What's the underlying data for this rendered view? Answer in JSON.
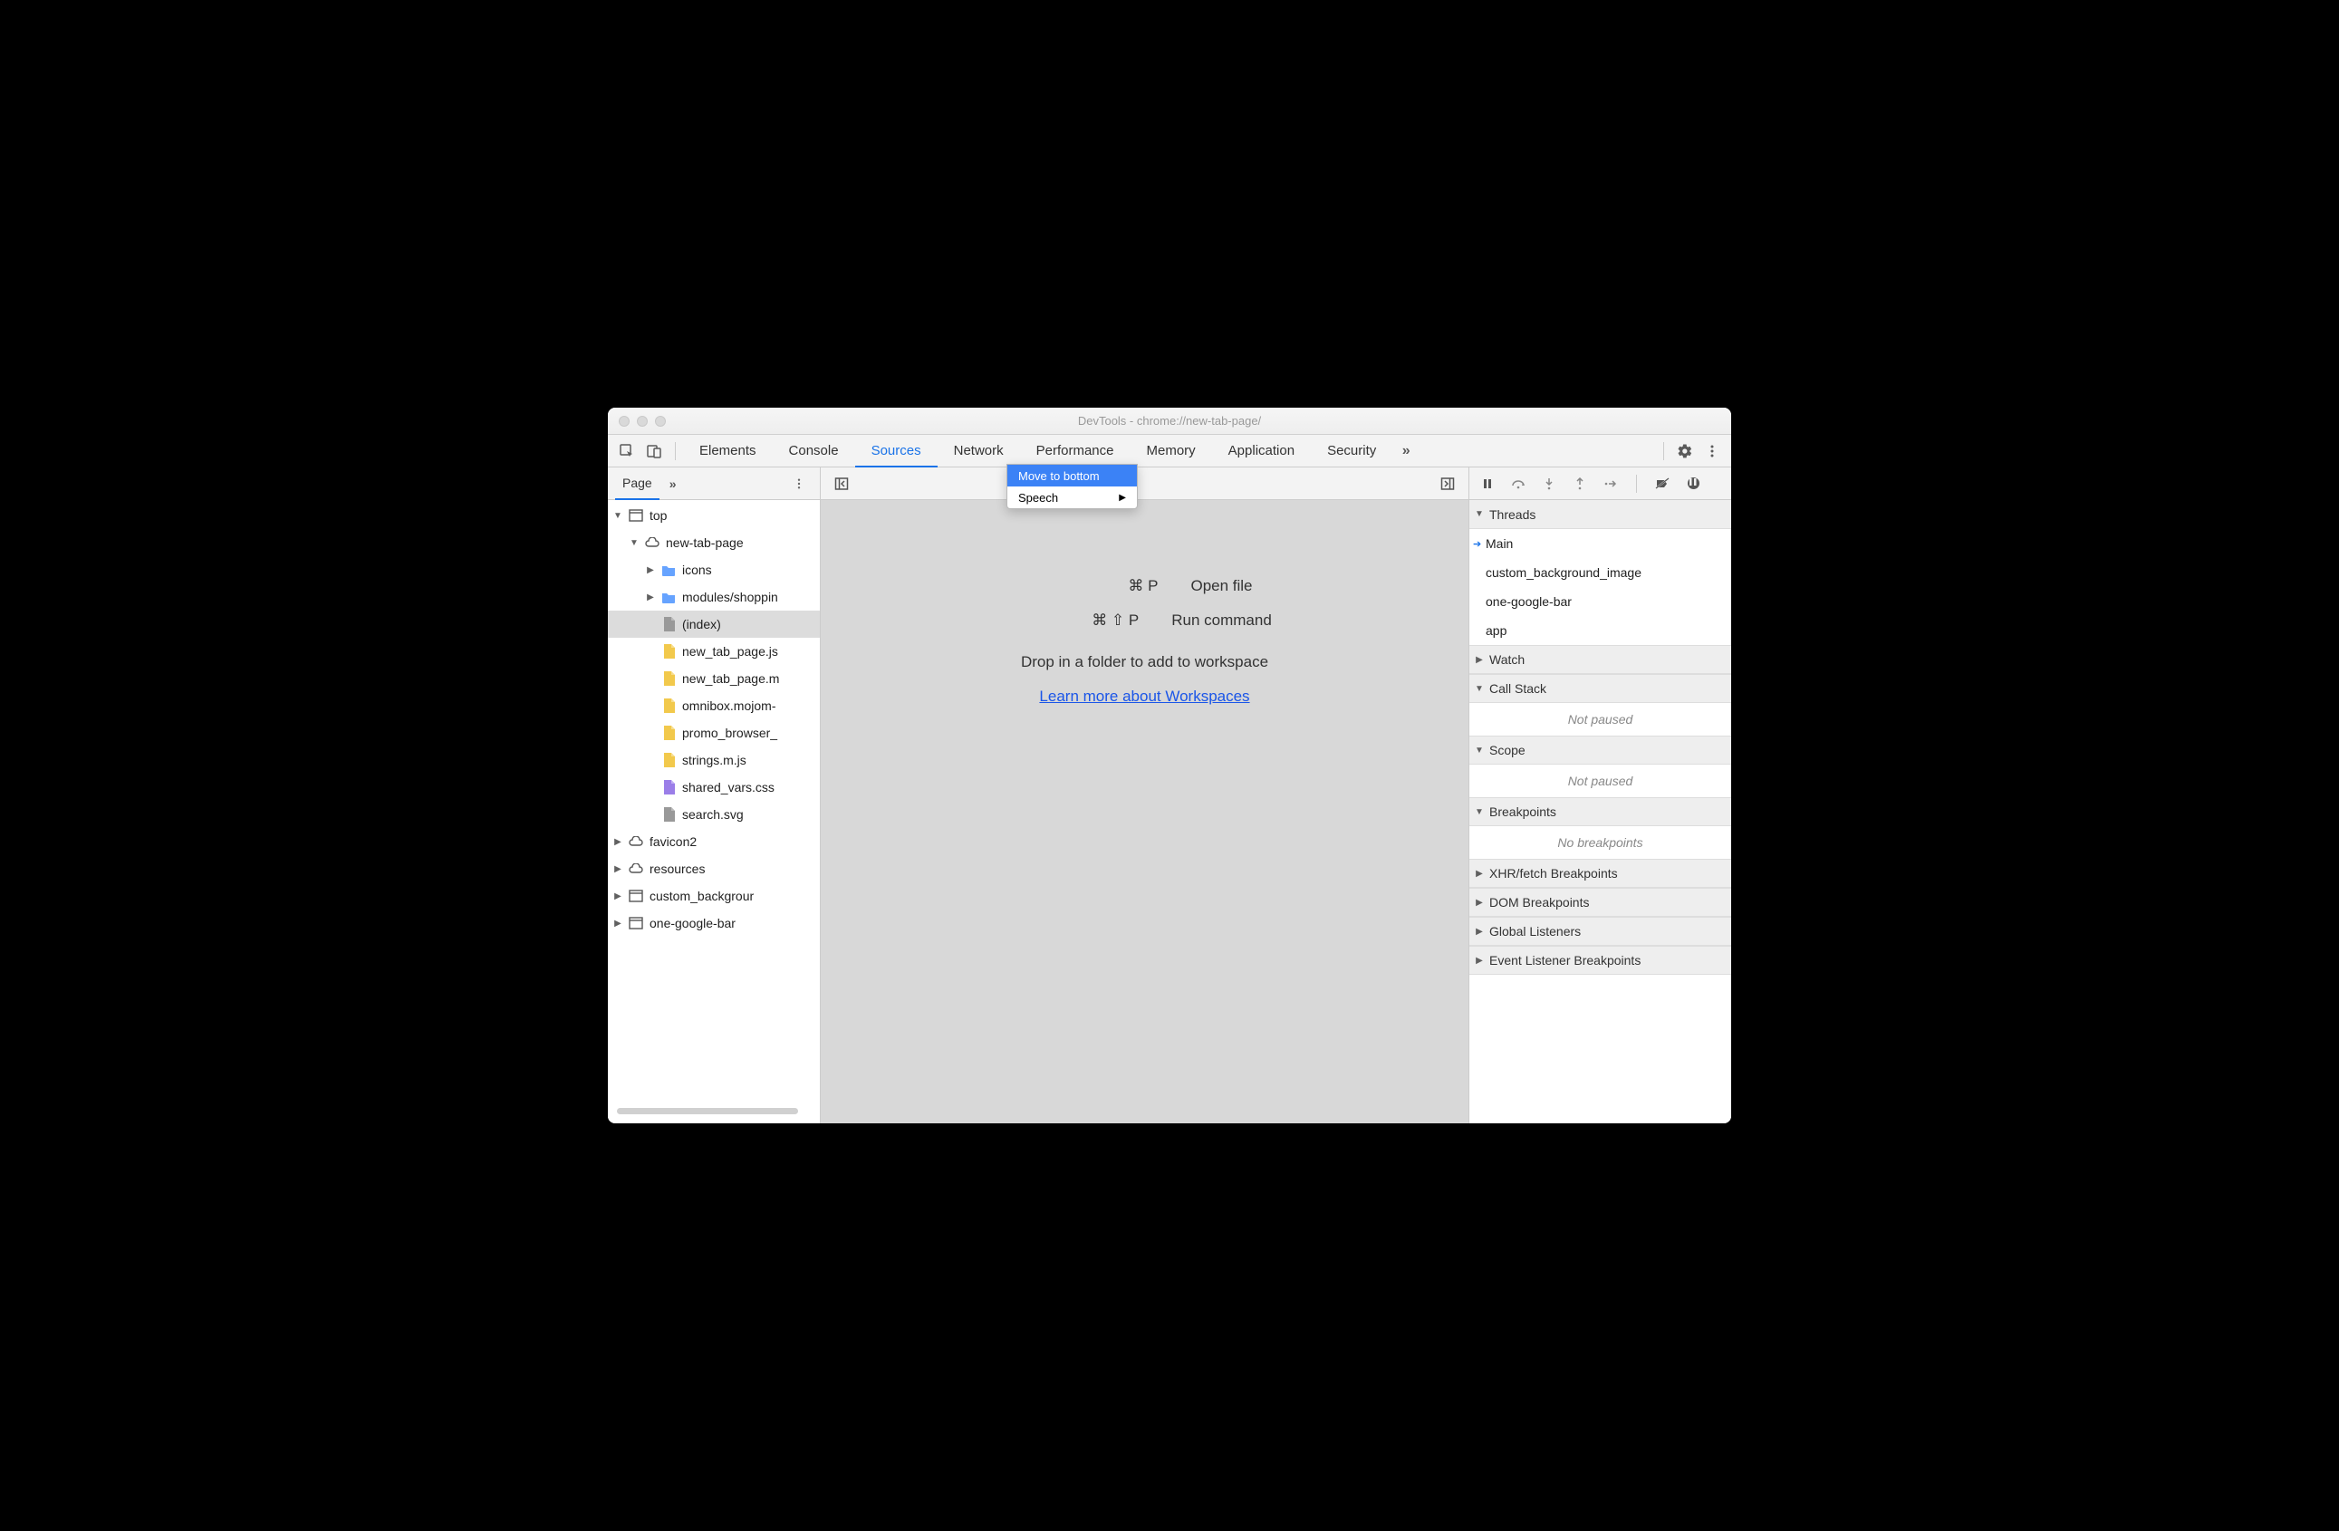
{
  "window": {
    "title": "DevTools - chrome://new-tab-page/"
  },
  "tabs": {
    "items": [
      "Elements",
      "Console",
      "Sources",
      "Network",
      "Performance",
      "Memory",
      "Application",
      "Security"
    ],
    "active": "Sources"
  },
  "left": {
    "subtab": "Page",
    "tree": [
      {
        "depth": 0,
        "arrow": "down",
        "icon": "frame",
        "label": "top"
      },
      {
        "depth": 1,
        "arrow": "down",
        "icon": "cloud",
        "label": "new-tab-page"
      },
      {
        "depth": 2,
        "arrow": "right",
        "icon": "folder",
        "label": "icons"
      },
      {
        "depth": 2,
        "arrow": "right",
        "icon": "folder",
        "label": "modules/shoppin"
      },
      {
        "depth": 2,
        "arrow": "",
        "icon": "doc-grey",
        "label": "(index)",
        "selected": true
      },
      {
        "depth": 2,
        "arrow": "",
        "icon": "doc-yellow",
        "label": "new_tab_page.js"
      },
      {
        "depth": 2,
        "arrow": "",
        "icon": "doc-yellow",
        "label": "new_tab_page.m"
      },
      {
        "depth": 2,
        "arrow": "",
        "icon": "doc-yellow",
        "label": "omnibox.mojom-"
      },
      {
        "depth": 2,
        "arrow": "",
        "icon": "doc-yellow",
        "label": "promo_browser_"
      },
      {
        "depth": 2,
        "arrow": "",
        "icon": "doc-yellow",
        "label": "strings.m.js"
      },
      {
        "depth": 2,
        "arrow": "",
        "icon": "doc-purple",
        "label": "shared_vars.css"
      },
      {
        "depth": 2,
        "arrow": "",
        "icon": "doc-grey",
        "label": "search.svg"
      },
      {
        "depth": 0,
        "arrow": "right",
        "icon": "cloud",
        "label": "favicon2"
      },
      {
        "depth": 0,
        "arrow": "right",
        "icon": "cloud",
        "label": "resources"
      },
      {
        "depth": 0,
        "arrow": "right",
        "icon": "frame",
        "label": "custom_backgrour"
      },
      {
        "depth": 0,
        "arrow": "right",
        "icon": "frame",
        "label": "one-google-bar"
      }
    ]
  },
  "center": {
    "shortcuts": [
      {
        "keys": "⌘ P",
        "label": "Open file"
      },
      {
        "keys": "⌘ ⇧ P",
        "label": "Run command"
      }
    ],
    "hint": "Drop in a folder to add to workspace",
    "link": "Learn more about Workspaces"
  },
  "context_menu": {
    "items": [
      {
        "label": "Move to bottom",
        "highlight": true,
        "submenu": false
      },
      {
        "label": "Speech",
        "highlight": false,
        "submenu": true
      }
    ]
  },
  "right": {
    "sections": [
      {
        "name": "Threads",
        "open": true,
        "rows": [
          {
            "label": "Main",
            "active": true
          },
          {
            "label": "custom_background_image"
          },
          {
            "label": "one-google-bar"
          },
          {
            "label": "app"
          }
        ]
      },
      {
        "name": "Watch",
        "open": false
      },
      {
        "name": "Call Stack",
        "open": true,
        "placeholder": "Not paused"
      },
      {
        "name": "Scope",
        "open": true,
        "placeholder": "Not paused"
      },
      {
        "name": "Breakpoints",
        "open": true,
        "placeholder": "No breakpoints"
      },
      {
        "name": "XHR/fetch Breakpoints",
        "open": false
      },
      {
        "name": "DOM Breakpoints",
        "open": false
      },
      {
        "name": "Global Listeners",
        "open": false
      },
      {
        "name": "Event Listener Breakpoints",
        "open": false
      }
    ]
  }
}
